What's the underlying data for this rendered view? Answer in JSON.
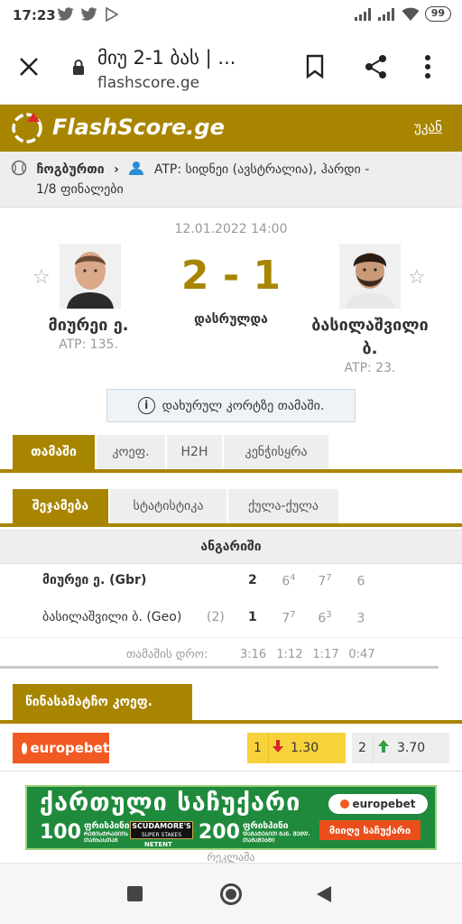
{
  "status_bar": {
    "time": "17:23",
    "battery": "99"
  },
  "browser": {
    "page_title": "მიუ 2-1 ბას | ...",
    "host": "flashscore.ge"
  },
  "header": {
    "logo_text": "FlashScore.ge",
    "back_label": "უკან",
    "brand_color": "#a88500"
  },
  "breadcrumb": {
    "sport": "ჩოგბურთი",
    "tournament": "ATP: სიდნეი (ავსტრალია), ჰარდი -",
    "stage": "1/8 ფინალები"
  },
  "match": {
    "datetime": "12.01.2022 14:00",
    "score": "2 - 1",
    "status": "დასრულდა",
    "home": {
      "name": "მიურეი ე.",
      "rank": "ATP: 135."
    },
    "away": {
      "name_line1": "ბასილაშვილი",
      "name_line2": "ბ.",
      "rank": "ATP: 23."
    },
    "info": "დახურულ კორტზე თამაში."
  },
  "main_tabs": [
    {
      "label": "თამაში",
      "active": true
    },
    {
      "label": "კოეფ.",
      "active": false
    },
    {
      "label": "H2H",
      "active": false
    },
    {
      "label": "კენჭისყრა",
      "active": false
    }
  ],
  "sub_tabs": [
    {
      "label": "შეჯამება",
      "active": true
    },
    {
      "label": "სტატისტიკა",
      "active": false
    },
    {
      "label": "ქულა-ქულა",
      "active": false
    }
  ],
  "scoreboard": {
    "heading": "ანგარიში",
    "rows": [
      {
        "player": "მიურეი ე. (Gbr)",
        "seed": "",
        "sets_won": "2",
        "s1": "6",
        "s1_tb": "4",
        "s2": "7",
        "s2_tb": "7",
        "s3": "6",
        "s3_tb": ""
      },
      {
        "player": "ბასილაშვილი ბ. (Geo)",
        "seed": "(2)",
        "sets_won": "1",
        "s1": "7",
        "s1_tb": "7",
        "s2": "6",
        "s2_tb": "3",
        "s3": "3",
        "s3_tb": ""
      }
    ],
    "duration_label": "თამაშის დრო:",
    "duration_total": "3:16",
    "durations": [
      "1:12",
      "1:17",
      "0:47"
    ]
  },
  "odds": {
    "title": "წინასამატჩო კოეფ.",
    "bookmaker": "europebet",
    "home_label": "1",
    "home_value": "1.30",
    "home_trend": "down",
    "away_label": "2",
    "away_value": "3.70",
    "away_trend": "up"
  },
  "banner": {
    "title": "ქართული საჩუქარი",
    "left_amount": "100",
    "left_word": "ფრისპინი",
    "left_lines": [
      "ᲠᲔᲒᲘᲡᲢᲠᲐᲪᲘᲘᲡ",
      "ᲗᲐᲜᲮᲐᲡᲗᲐᲜ"
    ],
    "partner": "SCUDAMORE'S",
    "partner_sub": "SUPER STAKES",
    "provider": "NETENT",
    "right_amount": "200",
    "right_word": "ფრისპინი",
    "right_lines": [
      "ᲓᲐᲛᲐᲢᲔᲑᲘᲗ ᲒᲐᲜ. ᲨᲔᲛᲓ.",
      "ᲗᲐᲛᲐᲨᲔᲑᲨᲘ"
    ],
    "logo": "europebet",
    "cta": "მიიღე საჩუქარი"
  },
  "ad_label": "რეკლამა"
}
